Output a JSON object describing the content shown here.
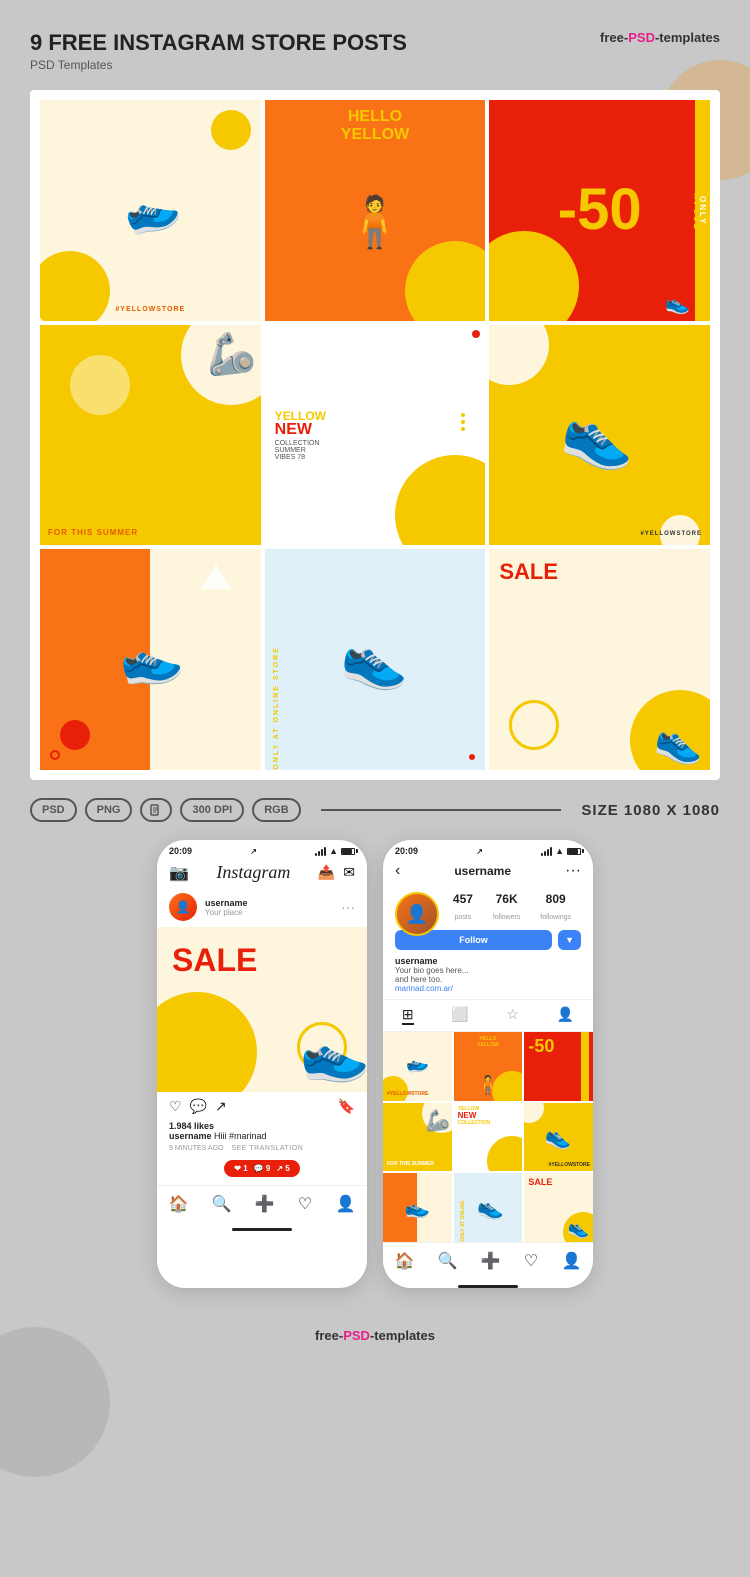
{
  "header": {
    "title": "9 FREE INSTAGRAM STORE POSTS",
    "subtitle": "PSD Templates",
    "brand": "free-PSD-templates"
  },
  "format_badges": [
    "PSD",
    "PNG",
    "300 DPI",
    "RGB"
  ],
  "size_label": "SIZE 1080 X 1080",
  "posts": [
    {
      "id": 1,
      "tag": "#YELLOWSTORE",
      "bg": "#fdf6dc"
    },
    {
      "id": 2,
      "title": "HELLO\nYELLOW",
      "bg": "#f97316"
    },
    {
      "id": 3,
      "number": "-50",
      "today": "TODAY ONLY",
      "bg": "#e8200a"
    },
    {
      "id": 4,
      "label_for": "FOR",
      "label_this": "THIS",
      "label_summer": "SUMMER",
      "bg": "#f5c800"
    },
    {
      "id": 5,
      "line1": "YELLOW",
      "line2": "NEW",
      "line3": "COLLECTION",
      "line4": "SUMMER",
      "line5": "VIBES 78",
      "bg": "white"
    },
    {
      "id": 6,
      "tag": "#YELLOWSTORE",
      "bg": "#f5c800"
    },
    {
      "id": 7,
      "bg": "#fdf6dc"
    },
    {
      "id": 8,
      "label": "ONLY AT ONLINE STORE",
      "bg": "#e0f0f8"
    },
    {
      "id": 9,
      "sale": "SALE",
      "bg": "#fdf6dc"
    }
  ],
  "phone1": {
    "status_time": "20:09",
    "app_name": "Instagram",
    "user": {
      "name": "username",
      "place": "Your place"
    },
    "post": {
      "sale_text": "SALE",
      "likes": "1.984 likes",
      "caption_user": "username",
      "caption_text": "Hiii #marinad",
      "time_ago": "9 MINUTES AGO",
      "see_translation": "SEE TRANSLATION"
    },
    "notifications": {
      "hearts": "1",
      "comments": "9",
      "shares": "5"
    },
    "nav": [
      "🏠",
      "🔍",
      "➕",
      "♡",
      "👤"
    ]
  },
  "phone2": {
    "status_time": "20:09",
    "header": {
      "back": "‹",
      "username": "username",
      "more": "..."
    },
    "stats": {
      "posts": {
        "value": "457",
        "label": "posts"
      },
      "followers": {
        "value": "76K",
        "label": "followers"
      },
      "followings": {
        "value": "809",
        "label": "followings"
      }
    },
    "follow_btn": "Follow",
    "bio": {
      "name": "username",
      "line1": "Your bio goes here...",
      "line2": "and here too.",
      "link": "marinad.com.ar/"
    },
    "tabs": [
      "grid",
      "reels",
      "tagged",
      "contact"
    ],
    "nav": [
      "🏠",
      "🔍",
      "➕",
      "♡",
      "👤"
    ]
  },
  "footer": {
    "brand": "free-PSD-templates"
  }
}
